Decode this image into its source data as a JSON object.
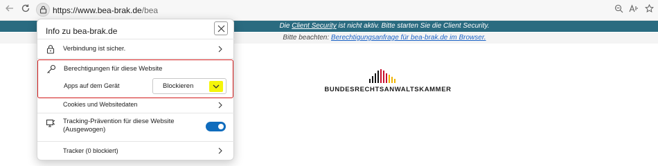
{
  "browser": {
    "url_host": "https://www.bea-brak.de",
    "url_path": "/bea"
  },
  "page": {
    "notice1": {
      "prefix": "Die ",
      "link": "Client Security",
      "suffix": " ist nicht aktiv. Bitte starten Sie die Client Security."
    },
    "notice2": {
      "prefix": "Bitte beachten: ",
      "link": "Berechtigungsanfrage für bea-brak.de im Browser."
    },
    "logo_text": "BUNDESRECHTSANWALTSKAMMER"
  },
  "popup": {
    "title": "Info zu bea-brak.de",
    "connection": "Verbindung ist sicher.",
    "permissions_heading": "Berechtigungen für diese Website",
    "apps_label": "Apps auf dem Gerät",
    "apps_value": "Blockieren",
    "cookies": "Cookies und Websitedaten",
    "tracking_line1": "Tracking-Prävention für diese Website",
    "tracking_line2": "(Ausgewogen)",
    "tracker": "Tracker (0 blockiert)",
    "tracking_enabled": true
  },
  "colors": {
    "notice_bar": "#2a6b80",
    "highlight_border": "#d11a1a",
    "dropdown_highlight": "#f5f50a",
    "toggle_on": "#0f6cbd"
  }
}
